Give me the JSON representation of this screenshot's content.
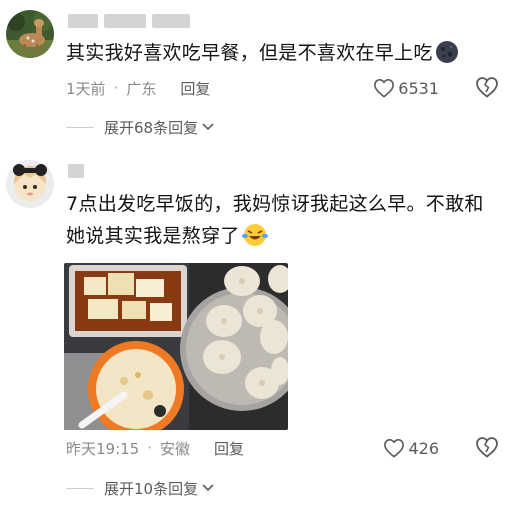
{
  "comments": [
    {
      "text": "其实我好喜欢吃早餐，但是不喜欢在早上吃",
      "emoji": "moon-face-emoji",
      "time": "1天前",
      "location": "广东",
      "reply_label": "回复",
      "likes": "6531",
      "expand_label": "展开68条回复"
    },
    {
      "text": "7点出发吃早饭的，我妈惊讶我起这么早。不敢和她说其实我是熬穿了",
      "emoji": "laughing-tears-emoji",
      "time": "昨天19:15",
      "location": "安徽",
      "reply_label": "回复",
      "likes": "426",
      "expand_label": "展开10条回复"
    }
  ],
  "colors": {
    "text": "#141414",
    "meta": "#8a8a8a",
    "secondary": "#5b5b5b",
    "username_redaction": "#d4d4d4"
  }
}
